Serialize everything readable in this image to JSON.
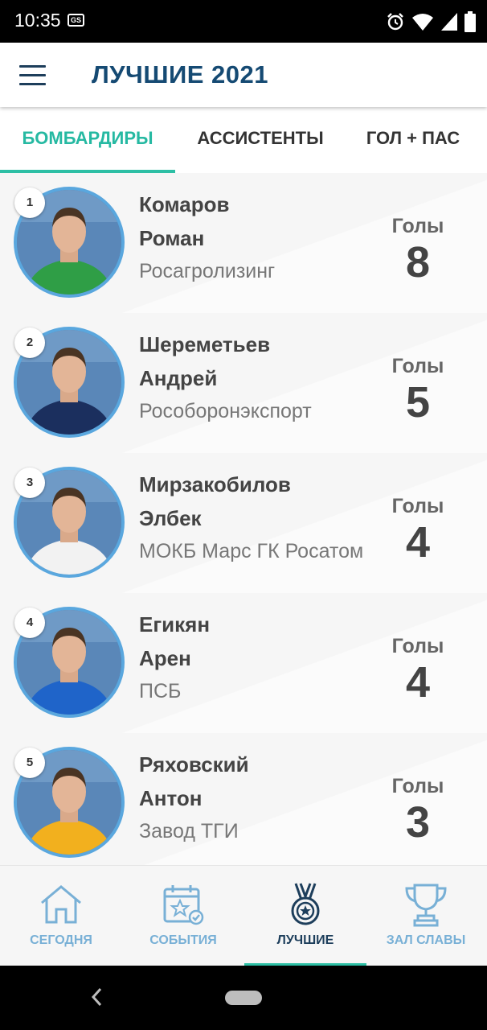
{
  "status_bar": {
    "time": "10:35",
    "gs_badge": "GS"
  },
  "header": {
    "title": "ЛУЧШИЕ 2021"
  },
  "tabs": [
    {
      "label": "БОМБАРДИРЫ",
      "active": true
    },
    {
      "label": "АССИСТЕНТЫ",
      "active": false
    },
    {
      "label": "ГОЛ + ПАС",
      "active": false
    }
  ],
  "players": [
    {
      "rank": "1",
      "first_line": "Комаров",
      "second_line": "Роман",
      "team": "Росагролизинг",
      "stat_label": "Голы",
      "stat_value": "8",
      "shirt_color": "#2f9e46"
    },
    {
      "rank": "2",
      "first_line": "Шереметьев",
      "second_line": "Андрей",
      "team": "Рособоронэкспорт",
      "stat_label": "Голы",
      "stat_value": "5",
      "shirt_color": "#1b2f5e"
    },
    {
      "rank": "3",
      "first_line": "Мирзакобилов",
      "second_line": "Элбек",
      "team": "МОКБ Марс ГК Росатом",
      "stat_label": "Голы",
      "stat_value": "4",
      "shirt_color": "#f2f2f2"
    },
    {
      "rank": "4",
      "first_line": "Егикян",
      "second_line": "Арен",
      "team": "ПСБ",
      "stat_label": "Голы",
      "stat_value": "4",
      "shirt_color": "#1f64c9"
    },
    {
      "rank": "5",
      "first_line": "Ряховский",
      "second_line": "Антон",
      "team": "Завод ТГИ",
      "stat_label": "Голы",
      "stat_value": "3",
      "shirt_color": "#f2b01e"
    }
  ],
  "bottom_nav": [
    {
      "label": "СЕГОДНЯ",
      "icon": "home-icon",
      "active": false
    },
    {
      "label": "СОБЫТИЯ",
      "icon": "calendar-star-icon",
      "active": false
    },
    {
      "label": "ЛУЧШИЕ",
      "icon": "medal-icon",
      "active": true
    },
    {
      "label": "ЗАЛ СЛАВЫ",
      "icon": "trophy-icon",
      "active": false
    }
  ],
  "colors": {
    "accent": "#2dbfa5",
    "title": "#154a73",
    "nav_inactive": "#78b0d6",
    "avatar_ring": "#5aa7de"
  }
}
